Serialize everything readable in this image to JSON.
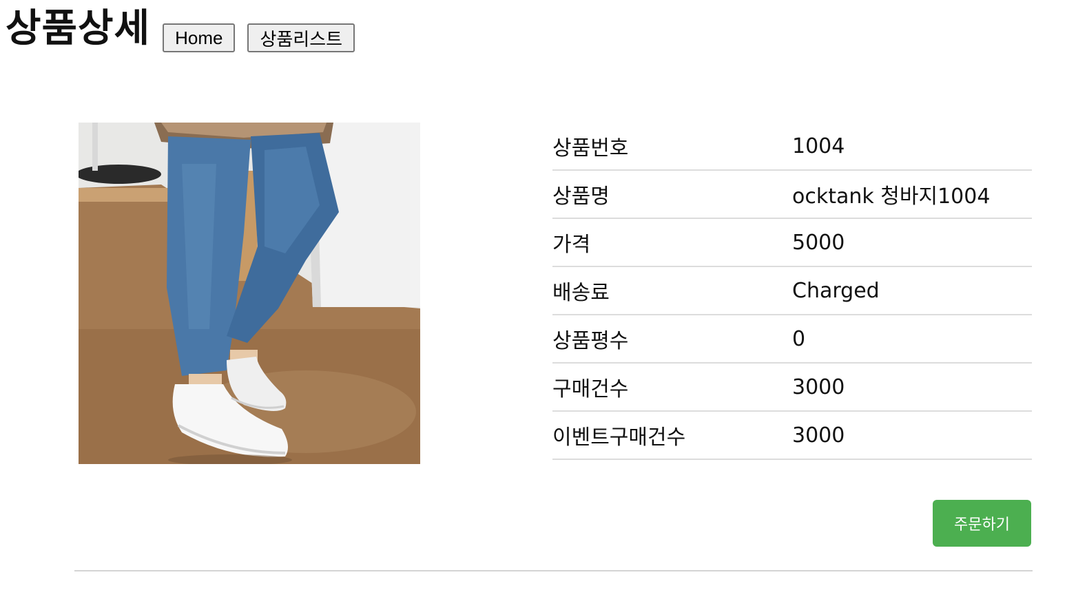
{
  "header": {
    "title": "상품상세",
    "home_label": "Home",
    "list_label": "상품리스트"
  },
  "product": {
    "image_subject": "jeans-and-sneakers-photo",
    "details": [
      {
        "label": "상품번호",
        "value": "1004"
      },
      {
        "label": "상품명",
        "value": "ocktank 청바지1004"
      },
      {
        "label": "가격",
        "value": "5000"
      },
      {
        "label": "배송료",
        "value": "Charged"
      },
      {
        "label": "상품평수",
        "value": "0"
      },
      {
        "label": "구매건수",
        "value": "3000"
      },
      {
        "label": "이벤트구매건수",
        "value": "3000"
      }
    ]
  },
  "actions": {
    "order_label": "주문하기"
  },
  "colors": {
    "order_button": "#4caf50",
    "divider": "#dcdcdc"
  }
}
